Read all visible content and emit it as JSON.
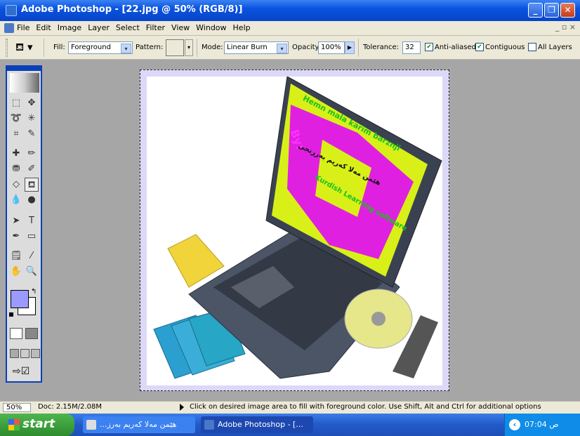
{
  "window": {
    "title": "Adobe Photoshop - [22.jpg @ 50% (RGB/8)]",
    "minimize_icon": "minimize-icon",
    "restore_icon": "restore-icon",
    "close_icon": "close-icon"
  },
  "menu": {
    "items": [
      "File",
      "Edit",
      "Image",
      "Layer",
      "Select",
      "Filter",
      "View",
      "Window",
      "Help"
    ],
    "doc_controls": "_ ▫ ×"
  },
  "options": {
    "fill_label": "Fill:",
    "fill_value": "Foreground",
    "pattern_label": "Pattern:",
    "mode_label": "Mode:",
    "mode_value": "Linear Burn",
    "opacity_label": "Opacity:",
    "opacity_value": "100%",
    "tolerance_label": "Tolerance:",
    "tolerance_value": "32",
    "anti_aliased_label": "Anti-aliased",
    "anti_aliased_checked": true,
    "contiguous_label": "Contiguous",
    "contiguous_checked": true,
    "all_layers_label": "All Layers",
    "all_layers_checked": false
  },
  "toolbox": {
    "foreground_color": "#9b9bff",
    "background_color": "#ffffff",
    "tools": [
      {
        "name": "marquee-tool-icon",
        "glyph": "⬚"
      },
      {
        "name": "move-tool-icon",
        "glyph": "✥"
      },
      {
        "name": "lasso-tool-icon",
        "glyph": "➰"
      },
      {
        "name": "magic-wand-tool-icon",
        "glyph": "✳"
      },
      {
        "name": "crop-tool-icon",
        "glyph": "⌗"
      },
      {
        "name": "slice-tool-icon",
        "glyph": "✎"
      },
      {
        "name": "healing-brush-tool-icon",
        "glyph": "✚"
      },
      {
        "name": "brush-tool-icon",
        "glyph": "✏"
      },
      {
        "name": "clone-stamp-tool-icon",
        "glyph": "⛃"
      },
      {
        "name": "history-brush-tool-icon",
        "glyph": "✐"
      },
      {
        "name": "eraser-tool-icon",
        "glyph": "◇"
      },
      {
        "name": "paint-bucket-tool-icon",
        "glyph": "⛾"
      },
      {
        "name": "blur-tool-icon",
        "glyph": "💧"
      },
      {
        "name": "dodge-tool-icon",
        "glyph": "●"
      },
      {
        "name": "path-selection-tool-icon",
        "glyph": "➤"
      },
      {
        "name": "type-tool-icon",
        "glyph": "T"
      },
      {
        "name": "pen-tool-icon",
        "glyph": "✒"
      },
      {
        "name": "rectangle-tool-icon",
        "glyph": "▭"
      },
      {
        "name": "notes-tool-icon",
        "glyph": "🗒"
      },
      {
        "name": "eyedropper-tool-icon",
        "glyph": "⁄"
      },
      {
        "name": "hand-tool-icon",
        "glyph": "✋"
      },
      {
        "name": "zoom-tool-icon",
        "glyph": "🔍"
      }
    ]
  },
  "canvas": {
    "screen_text": {
      "line1": "Hemn mala karim barznji",
      "line2": "By:",
      "line3": "هێمن مەلا كەریم بەرزنجی",
      "line4": "Kurdish Learning software"
    }
  },
  "status": {
    "zoom": "50%",
    "doc": "Doc: 2.15M/2.08M",
    "message": "Click on desired image area to fill with foreground color.  Use Shift, Alt and Ctrl for additional options"
  },
  "taskbar": {
    "start": "start",
    "item1": "...هێمن مەلا كەریم بەرز",
    "item2": "Adobe Photoshop - [...",
    "clock": "07:04 ص"
  }
}
